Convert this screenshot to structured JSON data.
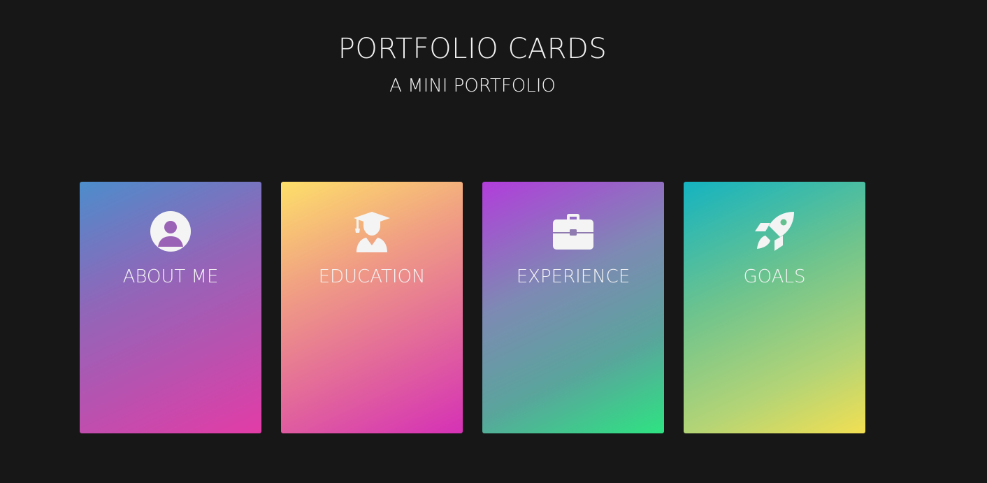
{
  "header": {
    "title": "PORTFOLIO CARDS",
    "subtitle": "A MINI PORTFOLIO"
  },
  "colors": {
    "background": "#171717",
    "text": "#f2f2f2"
  },
  "cards": [
    {
      "label": "ABOUT ME",
      "icon": "user-circle-icon"
    },
    {
      "label": "EDUCATION",
      "icon": "graduate-icon"
    },
    {
      "label": "EXPERIENCE",
      "icon": "briefcase-icon"
    },
    {
      "label": "GOALS",
      "icon": "rocket-icon"
    }
  ]
}
